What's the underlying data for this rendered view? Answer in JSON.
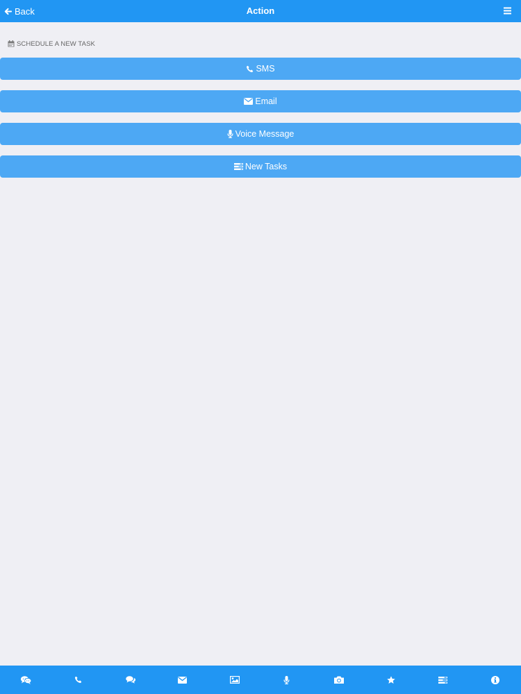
{
  "header": {
    "back_label": "Back",
    "title": "Action",
    "back_icon": "arrow-left-icon",
    "menu_icon": "hamburger-menu-icon"
  },
  "section": {
    "label": "SCHEDULE A NEW TASK",
    "icon": "calendar-icon"
  },
  "actions": [
    {
      "label": "SMS",
      "icon": "phone-icon"
    },
    {
      "label": "Email",
      "icon": "envelope-icon"
    },
    {
      "label": "Voice Message",
      "icon": "microphone-icon"
    },
    {
      "label": "New Tasks",
      "icon": "tasks-list-icon"
    }
  ],
  "bottom_nav": [
    {
      "icon": "chat-bubbles-icon"
    },
    {
      "icon": "phone-icon"
    },
    {
      "icon": "comments-icon"
    },
    {
      "icon": "envelope-icon"
    },
    {
      "icon": "image-icon"
    },
    {
      "icon": "microphone-icon"
    },
    {
      "icon": "camera-icon"
    },
    {
      "icon": "star-icon"
    },
    {
      "icon": "tasks-list-icon"
    },
    {
      "icon": "info-icon"
    }
  ],
  "colors": {
    "header_bg": "#2196f3",
    "button_bg": "#4da8f4",
    "page_bg": "#efeff4",
    "section_label": "#666666"
  }
}
